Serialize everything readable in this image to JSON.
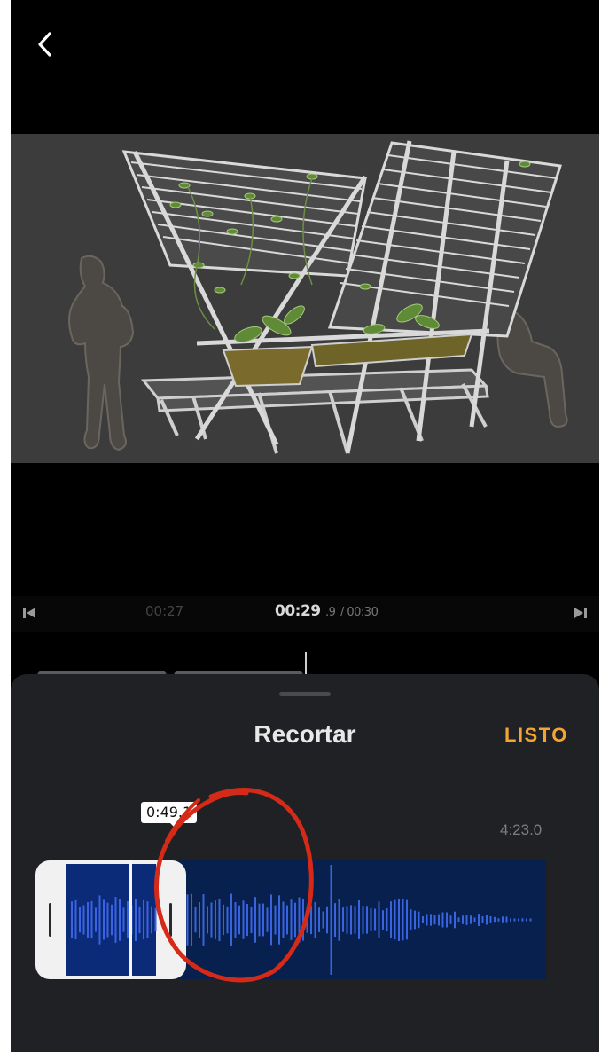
{
  "header": {
    "back_icon": "chevron-left-icon"
  },
  "timeline": {
    "prev_label": "00:27",
    "current_time": "00:29",
    "current_fraction": ".9",
    "total_time": "/ 00:30",
    "start_icon": "skip-to-start-icon",
    "end_icon": "skip-to-end-icon"
  },
  "trim_sheet": {
    "title": "Recortar",
    "done_label": "LISTO",
    "duration_label": "4:23.0",
    "selection_time": "0:49.1",
    "colors": {
      "accent": "#f2a530",
      "waveform": "#3a63e0",
      "track_bg": "#07204d",
      "annotation": "#d62a18"
    }
  }
}
